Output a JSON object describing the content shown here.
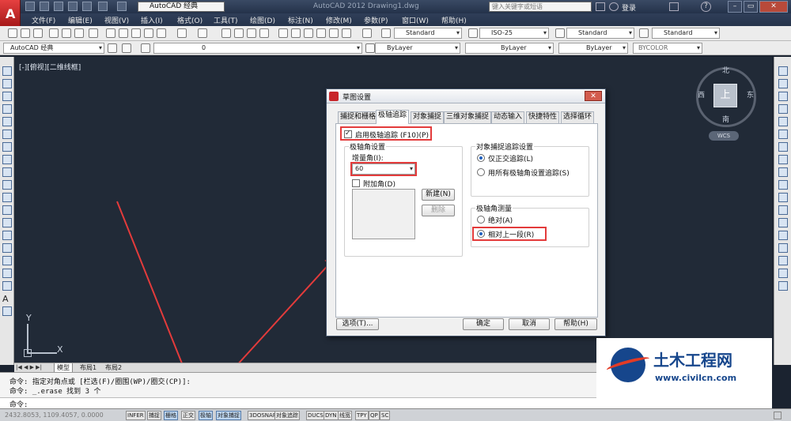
{
  "title_bar": {
    "workspace": "AutoCAD 经典",
    "app_title": "AutoCAD 2012   Drawing1.dwg",
    "search_placeholder": "键入关键字或短语",
    "login": "登录"
  },
  "menu": [
    "文件(F)",
    "编辑(E)",
    "视图(V)",
    "插入(I)",
    "格式(O)",
    "工具(T)",
    "绘图(D)",
    "标注(N)",
    "修改(M)",
    "参数(P)",
    "窗口(W)",
    "帮助(H)"
  ],
  "toolbar_styles": {
    "text_style": "Standard",
    "dim_style": "ISO-25",
    "table_style": "Standard",
    "mleader_style": "Standard"
  },
  "toolbar_layers": {
    "workspace": "AutoCAD 经典",
    "layer": "0",
    "color": "ByLayer",
    "linetype": "ByLayer",
    "lineweight": "ByLayer",
    "plotstyle": "BYCOLOR"
  },
  "viewport": {
    "label": "[-][俯视][二维线框]",
    "viewcube": {
      "north": "北",
      "south": "南",
      "east": "东",
      "west": "西",
      "face": "上",
      "wcs": "WCS"
    },
    "ucs": {
      "x": "X",
      "y": "Y"
    }
  },
  "model_tabs": [
    "模型",
    "布局1",
    "布局2"
  ],
  "command": {
    "history": [
      "命令: 指定对角点或 [栏选(F)/圈围(WP)/圈交(CP)]:",
      "命令: _.erase 找到 3 个"
    ],
    "prompt": "命令:"
  },
  "status": {
    "coords": "2432.8053, 1109.4057, 0.0000",
    "buttons": [
      {
        "label": "INFER",
        "on": false
      },
      {
        "label": "捕捉",
        "on": false
      },
      {
        "label": "栅格",
        "on": true
      },
      {
        "label": "正交",
        "on": false
      },
      {
        "label": "极轴",
        "on": true
      },
      {
        "label": "对象捕捉",
        "on": true
      },
      {
        "label": "3DOSNAP",
        "on": false
      },
      {
        "label": "对象追踪",
        "on": false
      },
      {
        "label": "DUCS",
        "on": false
      },
      {
        "label": "DYN",
        "on": false
      },
      {
        "label": "线宽",
        "on": false
      },
      {
        "label": "TPY",
        "on": false
      },
      {
        "label": "QP",
        "on": false
      },
      {
        "label": "SC",
        "on": false
      }
    ]
  },
  "dialog": {
    "title": "草图设置",
    "tabs": [
      "捕捉和栅格",
      "极轴追踪",
      "对象捕捉",
      "三维对象捕捉",
      "动态输入",
      "快捷特性",
      "选择循环"
    ],
    "active_tab": "极轴追踪",
    "enable_polar": "启用极轴追踪 (F10)(P)",
    "enable_polar_checked": true,
    "angle_group": "极轴角设置",
    "increment_label": "增量角(I):",
    "increment_value": "60",
    "additional_label": "附加角(D)",
    "additional_checked": false,
    "new_button": "新建(N)",
    "delete_button": "删除",
    "osnap_group": "对象捕捉追踪设置",
    "osnap_opt1": "仅正交追踪(L)",
    "osnap_opt2": "用所有极轴角设置追踪(S)",
    "measure_group": "极轴角测量",
    "measure_opt1": "绝对(A)",
    "measure_opt2": "相对上一段(R)",
    "options_button": "选项(T)...",
    "ok_button": "确定",
    "cancel_button": "取消",
    "help_button": "帮助(H)"
  },
  "watermark": {
    "title": "土木工程网",
    "url": "www.civilcn.com"
  },
  "colors": {
    "highlight": "#e33b3b",
    "canvas": "#212a37",
    "arrow": "#e33b3b"
  }
}
